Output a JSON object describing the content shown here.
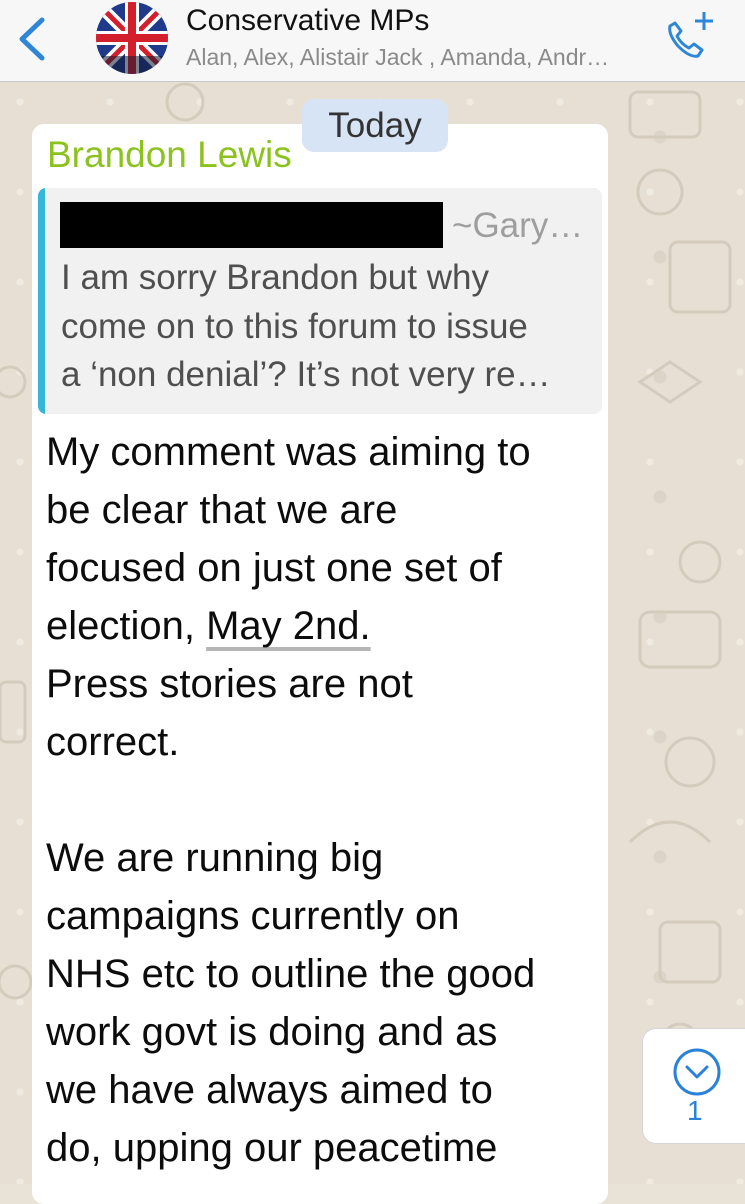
{
  "header": {
    "title": "Conservative MPs",
    "subtitle": "Alan, Alex, Alistair Jack , Amanda, Andr…",
    "icons": {
      "back": "chevron-left-icon",
      "call": "add-call-icon",
      "avatar": "union-flag-avatar"
    },
    "accent_color": "#2d86d8"
  },
  "date_divider": "Today",
  "message": {
    "sender": "Brandon Lewis",
    "sender_color": "#8cc21e",
    "quote": {
      "author": "~Gary…",
      "lines": [
        "I am sorry Brandon but why",
        "come on to this forum to issue",
        "a ‘non denial’? It’s not very re…"
      ],
      "bar_color": "#35b7d9"
    },
    "lines": [
      "My comment was aiming to",
      "be clear that we are",
      "focused on just one set of",
      "election, ",
      "May 2nd.",
      "Press stories are not",
      "correct.",
      "We are running big",
      "campaigns currently on",
      "NHS etc to outline the good",
      "work govt is doing and as",
      "we have always aimed to",
      "do, upping our peacetime"
    ]
  },
  "scroll_down": {
    "count": "1",
    "icon": "chevron-down-circle-icon"
  }
}
